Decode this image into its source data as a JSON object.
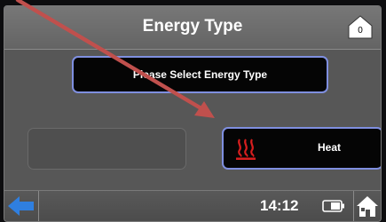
{
  "header": {
    "title": "Energy Type",
    "home_badge_count": "0"
  },
  "main": {
    "prompt_button_label": "Please Select Energy Type",
    "options": [
      {
        "label": "Heat",
        "icon": "heat-waves-icon"
      }
    ]
  },
  "footer": {
    "time": "14:12",
    "back_icon": "back-arrow-icon",
    "battery_icon": "battery-icon",
    "home_icon": "home-icon"
  },
  "colors": {
    "accent_border": "#7f8fe0",
    "heat_icon": "#d81e1e",
    "annotation_arrow": "#c0504d",
    "back_arrow": "#2f7fe0"
  }
}
